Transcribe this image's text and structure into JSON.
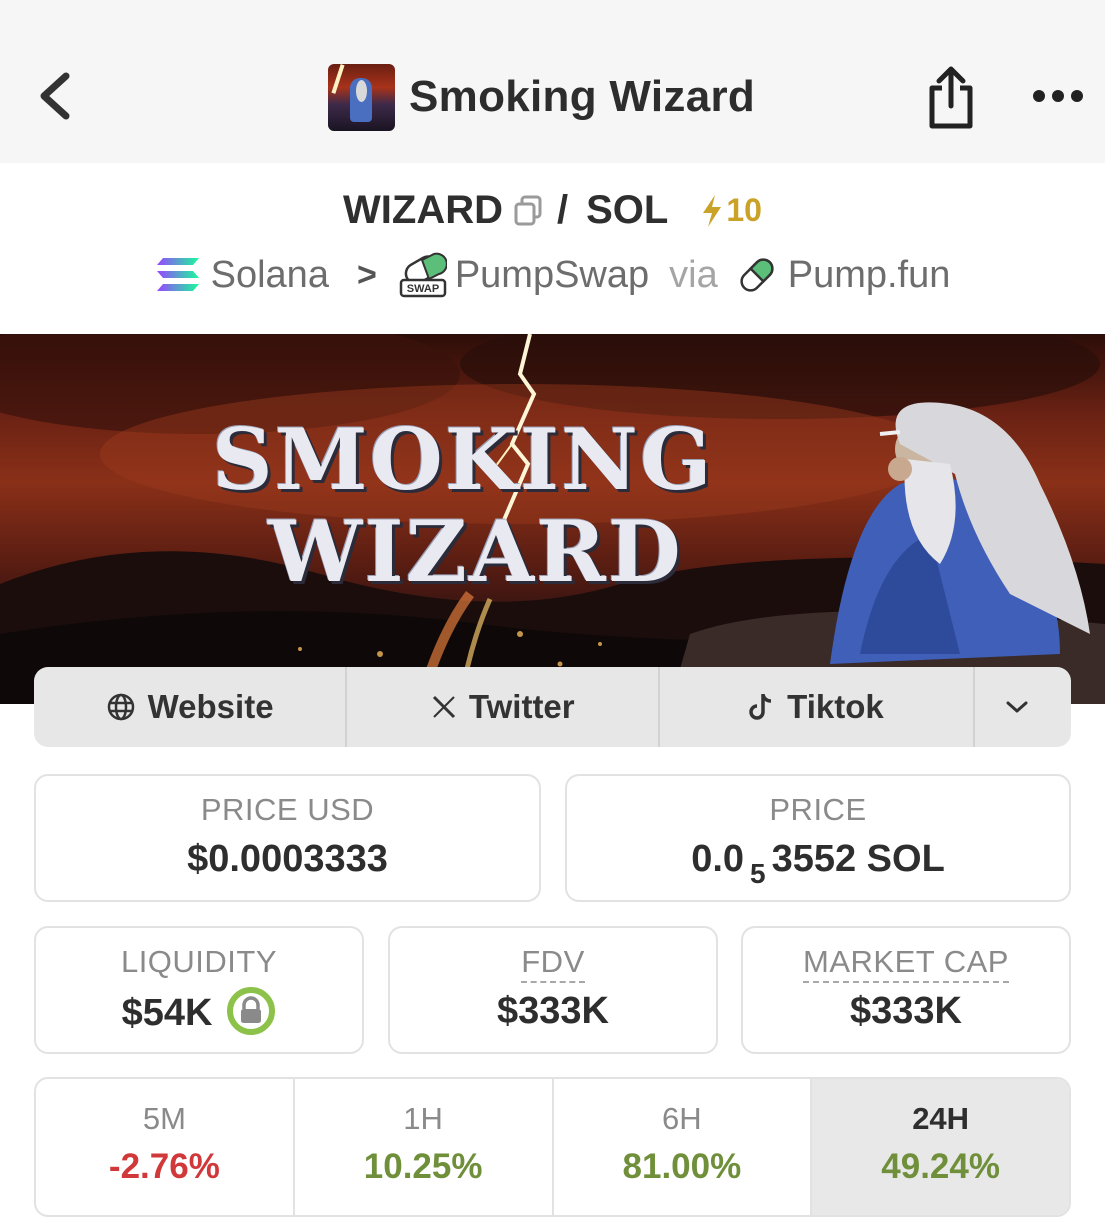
{
  "header": {
    "title": "Smoking Wizard"
  },
  "pair": {
    "base": "WIZARD",
    "quote": "SOL",
    "separator": "/",
    "boost": "10",
    "colors": {
      "boost": "#c9a227"
    }
  },
  "route": {
    "chain": "Solana",
    "dex": "PumpSwap",
    "via_label": "via",
    "launchpad": "Pump.fun",
    "dex_badge": "SWAP"
  },
  "banner": {
    "line1": "SMOKING",
    "line2": "WIZARD"
  },
  "links": {
    "website": "Website",
    "twitter": "Twitter",
    "tiktok": "Tiktok"
  },
  "stats": {
    "price_usd_label": "PRICE USD",
    "price_usd": "$0.0003333",
    "price_label": "PRICE",
    "price_prefix": "0.0",
    "price_zeros": "5",
    "price_suffix": "3552 SOL",
    "liquidity_label": "LIQUIDITY",
    "liquidity": "$54K",
    "fdv_label": "FDV",
    "fdv": "$333K",
    "mcap_label": "MARKET CAP",
    "mcap": "$333K"
  },
  "changes": [
    {
      "label": "5M",
      "value": "-2.76%",
      "trend": "negative"
    },
    {
      "label": "1H",
      "value": "10.25%",
      "trend": "positive"
    },
    {
      "label": "6H",
      "value": "81.00%",
      "trend": "positive"
    },
    {
      "label": "24H",
      "value": "49.24%",
      "trend": "positive",
      "selected": true
    }
  ],
  "colors": {
    "negative": "#d0383a",
    "positive": "#6f8f3a",
    "lock_ring": "#8cc24a"
  }
}
